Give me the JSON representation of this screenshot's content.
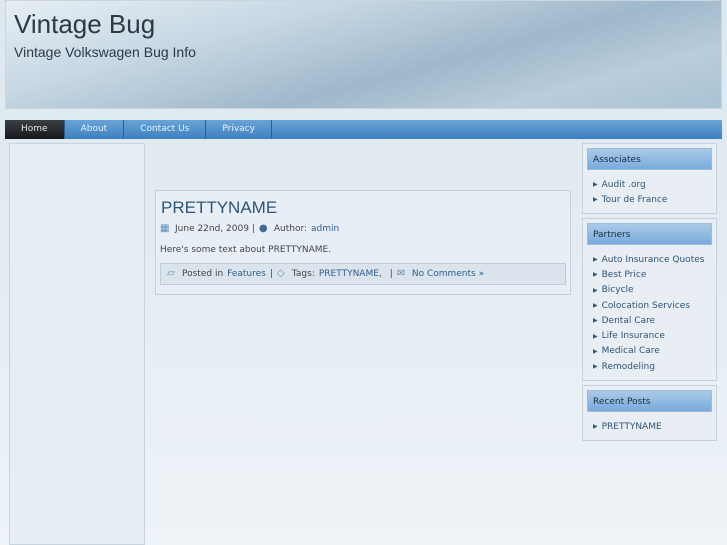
{
  "site": {
    "title": "Vintage Bug",
    "tagline": "Vintage Volkswagen Bug Info"
  },
  "nav": [
    {
      "label": "Home"
    },
    {
      "label": "About"
    },
    {
      "label": "Contact Us"
    },
    {
      "label": "Privacy"
    }
  ],
  "post": {
    "title": "PRETTYNAME",
    "date": "June 22nd, 2009 |",
    "author_label": "Author:",
    "author": "admin",
    "text": "Here's some text about PRETTYNAME.",
    "posted_in": "Posted in",
    "category": "Features",
    "sep1": "|",
    "tags_label": "Tags:",
    "tag": "PRETTYNAME",
    "tag_sep": ",",
    "sep2": "|",
    "comments": "No Comments »"
  },
  "widgets": {
    "associates": {
      "title": "Associates",
      "items": [
        "Audit .org",
        "Tour de France"
      ]
    },
    "partners": {
      "title": "Partners",
      "items": [
        "Auto Insurance Quotes",
        "Best Price",
        "Bicycle",
        "Colocation Services",
        "Dental Care",
        "Life Insurance",
        "Medical Care",
        "Remodeling"
      ]
    },
    "recent": {
      "title": "Recent Posts",
      "items": [
        "PRETTYNAME"
      ]
    }
  }
}
